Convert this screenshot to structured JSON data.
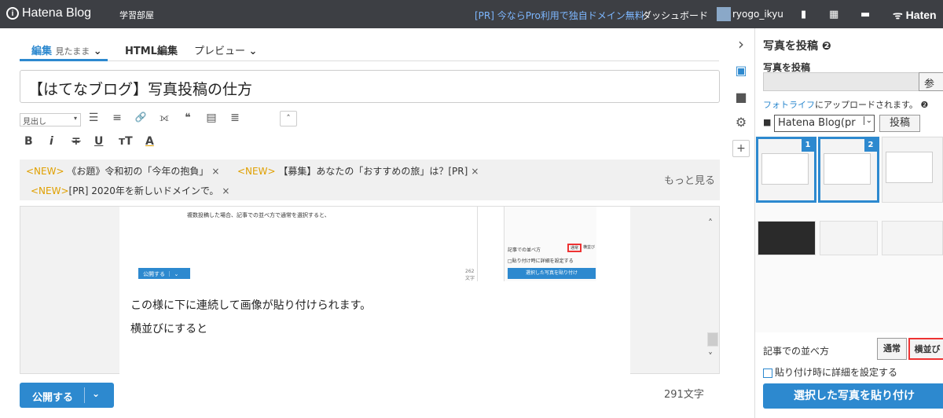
{
  "topbar": {
    "logo_mark": "i",
    "logo_text": "Hatena Blog",
    "blog_name": "学習部屋",
    "promo": "[PR] 今ならPro利用で独自ドメイン無料",
    "dashboard": "ダッシュボード",
    "username": "ryogo_ikyu",
    "bookmark_icon": "▮",
    "grid_icon": "▦",
    "comment_icon": "▬",
    "brand": "ᯤ Haten"
  },
  "tabs": {
    "edit": "編集",
    "edit_mode": "見たまま",
    "edit_chevron": "⌄",
    "html_edit": "HTML編集",
    "preview": "プレビュー",
    "preview_chevron": "⌄"
  },
  "title": "【はてなブログ】写真投稿の仕方",
  "toolbar": {
    "heading_select": "見出し",
    "heading_arrow": "▾",
    "icons": {
      "bullet_list": "☰",
      "numbered_list": "≡",
      "link": "🔗",
      "more": "⟗",
      "quote": "❝",
      "table": "▤",
      "code": "≣",
      "collapse": "˄"
    },
    "bold": "B",
    "italic": "i",
    "strike": "∓",
    "underline": "U",
    "font_size": "ᴛT",
    "color": "A"
  },
  "news": [
    {
      "tag": "<NEW>",
      "text": "《お題》令和初の「今年の抱負」",
      "close": "×"
    },
    {
      "tag": "<NEW>",
      "text": "【募集】あなたの「おすすめの旅」は？[PR]",
      "close": "×"
    },
    {
      "tag": "<NEW>",
      "text": "[PR] 2020年を新しいドメインで。",
      "close": "×"
    }
  ],
  "news_more": "もっと見る",
  "editor": {
    "shot_text": "複数投稿した場合、記事での並べ方で通常を選択すると、",
    "shot_publish": "公開する ｜ ⌄",
    "shot_count": "262文字",
    "shot_order_label": "記事での並べ方",
    "shot_btn_normal": "通常",
    "shot_btn_horizontal": "横並び",
    "shot_detail": "□貼り付け時に詳細を設定する",
    "shot_paste": "選択した写真を貼り付け",
    "line1": "この様に下に連続して画像が貼り付けられます。",
    "line2": "横並びにすると",
    "scroll_up": "˄",
    "scroll_down": "˅"
  },
  "publish": {
    "label": "公開する",
    "chevron": "⌄"
  },
  "char_count": "291文字",
  "sidebar": {
    "collapse_icon": "›",
    "photo_icon": "▣",
    "folder_icon": "■",
    "gear_icon": "⚙",
    "plus_icon": "+"
  },
  "panel": {
    "heading": "写真を投稿 ❷",
    "sub_heading": "写真を投稿",
    "browse": "参",
    "fotolife_link": "フォトライフ",
    "fotolife_text": "にアップロードされます。 ❷",
    "folder_icon": "■",
    "folder_select": "Hatena Blog(pr",
    "folder_arrow": "⌄",
    "upload": "投稿",
    "thumbs": [
      {
        "badge": "1"
      },
      {
        "badge": "2"
      }
    ],
    "order_label": "記事での並べ方",
    "order_normal": "通常",
    "order_horizontal": "横並び",
    "detail_label": "貼り付け時に詳細を設定する",
    "paste_button": "選択した写真を貼り付け"
  }
}
